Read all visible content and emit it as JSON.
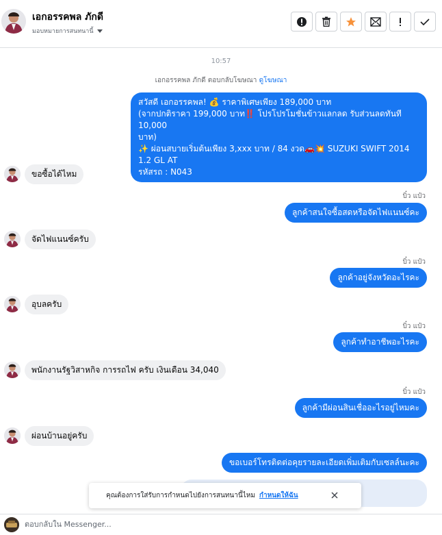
{
  "header": {
    "name": "เอกอรรคพล ภักดี",
    "subtitle": "มอบหมายการสนทนานี้",
    "actions": [
      {
        "name": "mark-spam-icon",
        "glyph": "!"
      },
      {
        "name": "trash-icon",
        "glyph": ""
      },
      {
        "name": "star-icon",
        "glyph": "★"
      },
      {
        "name": "mark-unread-icon",
        "glyph": ""
      },
      {
        "name": "exclamation-icon",
        "glyph": "!"
      },
      {
        "name": "checkmark-icon",
        "glyph": "✓"
      }
    ]
  },
  "chat": {
    "time": "10:57",
    "ad_note": "เอกอรรคพล ภักดี ตอบกลับโฆษณา",
    "ad_link": "ดูโฆษณา",
    "intro_message": "สวัสดี เอกอรรคพล! 💰 ราคาพิเศษเพียง 189,000 บาท\n(จากปกติราคา 199,000 บาท‼️ โปรโปรโมชั่นข้าวแลกลด รับส่วนลดทันที 10,000\nบาท)\n✨ ผ่อนสบายเริ่มต้นเพียง 3,xxx บาท / 84 งวด🚗💥 SUZUKI SWIFT 2014 1.2 GL AT\nรหัสรถ : N043",
    "sender_name": "บิ๋ว แป๋ว",
    "messages": [
      {
        "in": "ขอซื้อได้ไหม",
        "out": "ลูกค้าสนใจซื้อสดหรือจัดไฟแนนซ์คะ"
      },
      {
        "in": "จัดไฟแนนซ์ครับ",
        "out": "ลูกค้าอยู่จังหวัดอะไรคะ"
      },
      {
        "in": "อุบลครับ",
        "out": "ลูกค้าทำอาชีพอะไรคะ"
      },
      {
        "in": "พนักงานรัฐวิสาหกิจ การรถไฟ ครับ เงินเดือน 34,040",
        "out": "ลูกค้ามีผ่อนสินเชื่ออะไรอยู่ไหมคะ"
      },
      {
        "in": "ผ่อนบ้านอยู่ครับ",
        "out": "ขอเบอร์โทรติดต่อคุยรายละเอียดเพิ่มเติมกับเซลล์นะคะ"
      }
    ]
  },
  "toast": {
    "text": "คุณต้องการใส่รับการกำหนดไปยังการสนทนานี้ไหม",
    "link": "กำหนดให้ฉัน"
  },
  "footer": {
    "placeholder": "ตอบกลับใน Messenger..."
  },
  "colors": {
    "accent": "#1877f2",
    "incoming_bubble": "#eff0f2",
    "star": "#f7923b"
  }
}
